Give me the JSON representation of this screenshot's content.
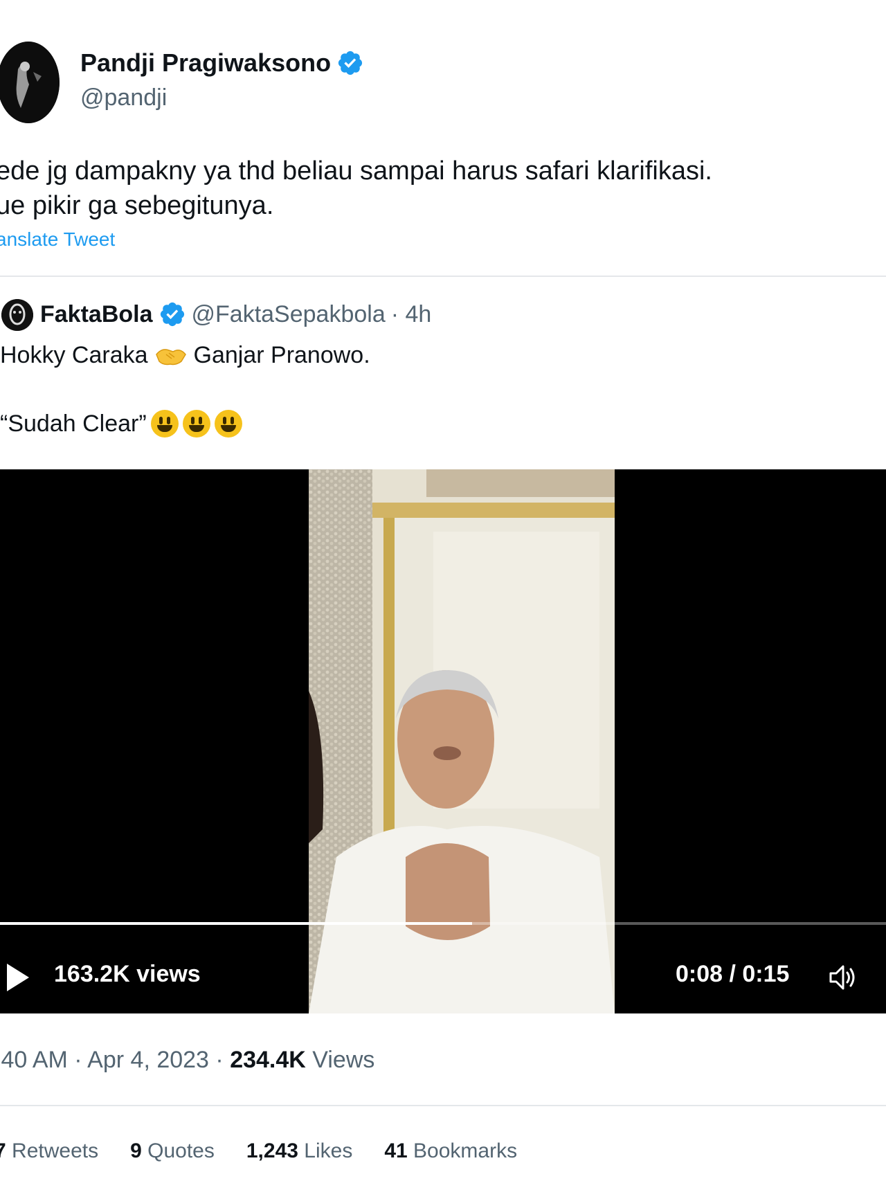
{
  "author": {
    "display_name": "Pandji Pragiwaksono",
    "handle": "@pandji"
  },
  "tweet": {
    "line1": "ede jg dampakny ya thd beliau sampai harus safari klarifikasi.",
    "line2": "ue pikir ga sebegitunya.",
    "translate_label": "anslate Tweet"
  },
  "quoted": {
    "display_name": "FaktaBola",
    "handle": "@FaktaSepakbola",
    "time": "· 4h",
    "text_left": "Hokky Caraka",
    "text_right": "Ganjar Pranowo.",
    "quote_text": "“Sudah Clear”",
    "handshake_emoji": "handshake-emoji",
    "smile_emoji": "grinning-face-emoji"
  },
  "video": {
    "views": "163.2K views",
    "time": "0:08 / 0:15",
    "progress": 0.533
  },
  "meta": {
    "time_date": ":40 AM · Apr 4, 2023 ·",
    "views_count": "234.4K",
    "views_label": "Views"
  },
  "stats": {
    "retweets_count": "7",
    "retweets_label": "Retweets",
    "quotes_count": "9",
    "quotes_label": "Quotes",
    "likes_count": "1,243",
    "likes_label": "Likes",
    "bookmarks_count": "41",
    "bookmarks_label": "Bookmarks"
  },
  "colors": {
    "link": "#1d9bf0",
    "verified": "#1d9bf0",
    "secondary_text": "#536471"
  }
}
